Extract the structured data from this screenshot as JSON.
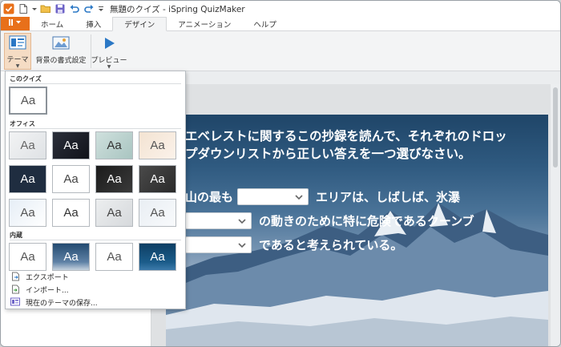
{
  "window": {
    "title": "無題のクイズ - iSpring QuizMaker"
  },
  "quick_access": {
    "icons": [
      "app-logo-icon",
      "new-file-icon",
      "open-folder-icon",
      "save-icon",
      "undo-icon",
      "redo-icon",
      "customize-qat-icon"
    ]
  },
  "tabs": {
    "file_label": "",
    "items": [
      {
        "label": "ホーム"
      },
      {
        "label": "挿入"
      },
      {
        "label": "デザイン",
        "active": true
      },
      {
        "label": "アニメーション"
      },
      {
        "label": "ヘルプ"
      }
    ]
  },
  "ribbon": {
    "theme_label": "テーマ",
    "background_label": "背景の書式設定",
    "preview_label": "プレビュー"
  },
  "theme_panel": {
    "section_this_quiz": "このクイズ",
    "section_office": "オフィス",
    "section_builtin": "内蔵",
    "thumb_text": "Aa",
    "menu": {
      "export": "エクスポート",
      "import": "インポート...",
      "save_current": "現在のテーマの保存..."
    }
  },
  "slide": {
    "question_line1": "エベレストに関するこの抄録を読んで、それぞれのドロッ",
    "question_line2": "プダウンリストから正しい答えを一つ選びなさい。",
    "line1_prefix": "山の最も",
    "line1_suffix": "エリアは、しばしば、氷瀑",
    "line2_suffix": "の動きのために特に危険であるクーンブ",
    "line3_suffix": "であると考えられている。"
  },
  "colors": {
    "file_tab": "#e8701a",
    "theme_button_active": "#f5dcc4",
    "accent_blue": "#2b78c5"
  }
}
